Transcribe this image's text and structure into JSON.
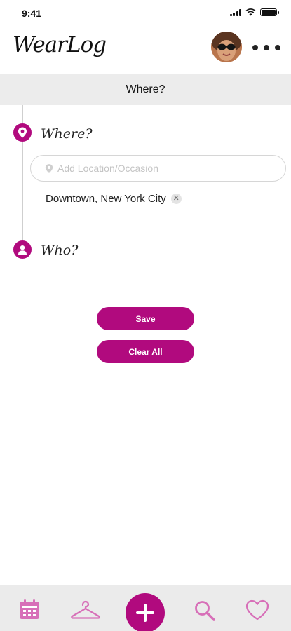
{
  "status_bar": {
    "time": "9:41"
  },
  "header": {
    "app_name": "WearLog",
    "avatar_icon": "user-avatar-photo",
    "more_icon": "more-dots-icon"
  },
  "section": {
    "title": "Where?"
  },
  "where": {
    "label": "Where?",
    "icon": "location-pin-icon",
    "input_placeholder": "Add Location/Occasion",
    "input_value": "",
    "tags": [
      {
        "label": "Downtown, New York City",
        "remove_icon": "close-icon"
      }
    ]
  },
  "who": {
    "label": "Who?",
    "icon": "person-icon"
  },
  "actions": {
    "save_label": "Save",
    "clear_label": "Clear All"
  },
  "bottom_nav": {
    "items": [
      {
        "icon": "calendar-icon"
      },
      {
        "icon": "hanger-icon"
      },
      {
        "icon": "plus-icon"
      },
      {
        "icon": "search-icon"
      },
      {
        "icon": "heart-icon"
      }
    ]
  },
  "colors": {
    "accent": "#b10a7e",
    "nav_icon": "#d76fb8",
    "section_bar": "#ececec",
    "nav_bar": "#ebebeb"
  }
}
